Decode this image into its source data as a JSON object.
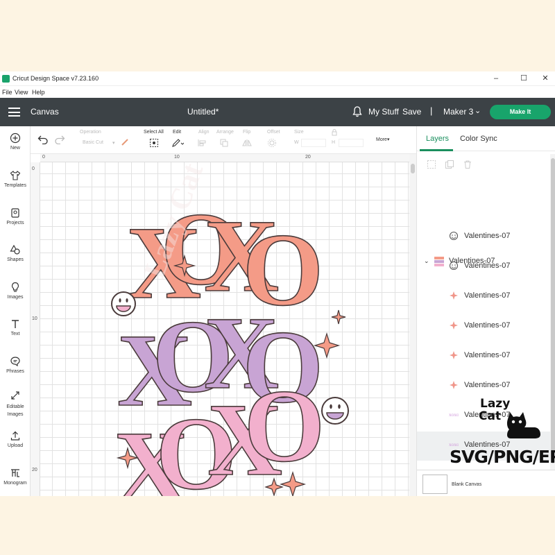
{
  "window": {
    "title": "Cricut Design Space  v7.23.160",
    "min": "–",
    "max": "☐",
    "close": "✕"
  },
  "menu": [
    "File",
    "View",
    "Help"
  ],
  "header": {
    "canvas": "Canvas",
    "doc_title": "Untitled*",
    "my_stuff": "My Stuff",
    "save": "Save",
    "separator": "|",
    "machine": "Maker 3",
    "chevron": "⌄",
    "make_it": "Make It"
  },
  "leftbar": [
    {
      "label": "New",
      "icon": "plus-circle-icon"
    },
    {
      "label": "Templates",
      "icon": "shirt-icon"
    },
    {
      "label": "Projects",
      "icon": "projects-icon"
    },
    {
      "label": "Shapes",
      "icon": "shapes-icon"
    },
    {
      "label": "Images",
      "icon": "lightbulb-icon"
    },
    {
      "label": "Text",
      "icon": "text-icon"
    },
    {
      "label": "Phrases",
      "icon": "speech-bubble-icon"
    },
    {
      "label": "Editable Images",
      "icon": "editable-images-icon"
    },
    {
      "label": "Upload",
      "icon": "upload-icon"
    },
    {
      "label": "Monogram",
      "icon": "monogram-icon"
    }
  ],
  "toolbar": {
    "operation": "Operation",
    "basic_cut": "Basic Cut",
    "select_all": "Select All",
    "edit": "Edit",
    "align": "Align",
    "arrange": "Arrange",
    "flip": "Flip",
    "offset": "Offset",
    "size": "Size",
    "w": "W",
    "h": "H",
    "more": "More▾"
  },
  "ruler": {
    "top": [
      "0",
      "10",
      "20"
    ],
    "left": [
      "0",
      "10",
      "20"
    ]
  },
  "panel": {
    "tabs": [
      "Layers",
      "Color Sync"
    ],
    "group": "Valentines-07",
    "layers": [
      {
        "name": "Valentines-07",
        "icon": "smiley-icon"
      },
      {
        "name": "Valentines-07",
        "icon": "smiley-icon"
      },
      {
        "name": "Valentines-07",
        "icon": "star-icon"
      },
      {
        "name": "Valentines-07",
        "icon": "star-icon"
      },
      {
        "name": "Valentines-07",
        "icon": "star-icon"
      },
      {
        "name": "Valentines-07",
        "icon": "star-icon"
      },
      {
        "name": "Valentines-07",
        "icon": "xoxo-thumbnail-icon"
      },
      {
        "name": "Valentines-07",
        "icon": "xoxo-thumbnail-icon"
      }
    ],
    "blank_canvas": "Blank Canvas"
  },
  "design": {
    "rows": [
      "XOXO",
      "XOXO",
      "XOXO"
    ],
    "colors": [
      "#f49b87",
      "#c8a4d4",
      "#f2b0cd"
    ],
    "outline": "#4a3b3b"
  },
  "badge": {
    "line1": "Lazy",
    "line2": "Cat",
    "formats": "SVG/PNG/EPS"
  }
}
